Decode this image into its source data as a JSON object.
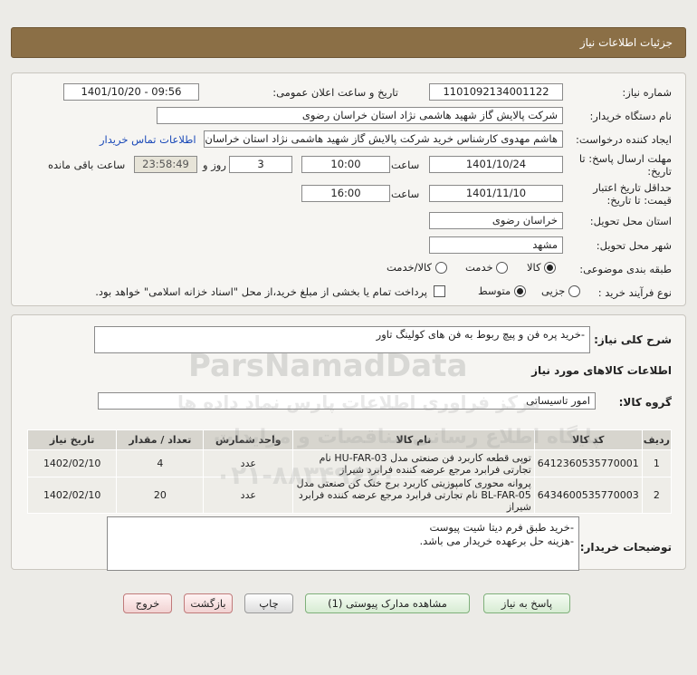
{
  "header": {
    "title": "جزئیات اطلاعات نیاز"
  },
  "info": {
    "need_number_label": "شماره نیاز:",
    "need_number": "1101092134001122",
    "announce_label": "تاریخ و ساعت اعلان عمومی:",
    "announce_value": "1401/10/20 - 09:56",
    "buyer_org_label": "نام دستگاه خریدار:",
    "buyer_org": "شرکت پالایش گاز شهید هاشمی نژاد   استان خراسان رضوی",
    "creator_label": "ایجاد کننده درخواست:",
    "creator": "هاشم مهدوی کارشناس خرید شرکت پالایش گاز شهید هاشمی نژاد   استان خراسان رضوی",
    "contact_link": "اطلاعات تماس خریدار",
    "deadline_label_1": "مهلت ارسال پاسخ: تا",
    "deadline_label_2": "تاریخ:",
    "deadline_date": "1401/10/24",
    "time_label": "ساعت",
    "deadline_time": "10:00",
    "days_value": "3",
    "days_label": "روز و",
    "remaining_time": "23:58:49",
    "remaining_label": "ساعت باقی مانده",
    "validity_label_1": "حداقل تاریخ اعتبار",
    "validity_label_2": "قیمت: تا تاریخ:",
    "validity_date": "1401/11/10",
    "validity_time": "16:00",
    "province_label": "استان محل تحویل:",
    "province": "خراسان رضوی",
    "city_label": "شهر محل تحویل:",
    "city": "مشهد",
    "category_label": "طبقه بندی موضوعی:",
    "category_options": [
      "کالا",
      "خدمت",
      "کالا/خدمت"
    ],
    "process_label": "نوع فرآیند خرید :",
    "process_options": [
      "جزیی",
      "متوسط"
    ],
    "payment_note": "پرداخت تمام یا بخشی از مبلغ خرید،از محل \"اسناد خزانه اسلامی\" خواهد بود."
  },
  "description": {
    "label": "شرح کلی نیاز:",
    "value": "-خرید پره فن و پیچ ربوط به فن های کولینگ تاور"
  },
  "goods": {
    "section_title": "اطلاعات کالاهای مورد نیاز",
    "group_label": "گروه کالا:",
    "group_value": "امور تاسیساتی",
    "columns": [
      "ردیف",
      "کد کالا",
      "نام کالا",
      "واحد شمارش",
      "تعداد / مقدار",
      "تاریخ نیاز"
    ],
    "rows": [
      {
        "row": "1",
        "code": "6412360535770001",
        "name": "توپی قطعه کاربرد فن صنعتی مدل HU-FAR-03 نام تجارتی فرابرد مرجع عرضه کننده فرابرد شیراز",
        "unit": "عدد",
        "qty": "4",
        "date": "1402/02/10"
      },
      {
        "row": "2",
        "code": "6434600535770003",
        "name": "پروانه محوری کامپوزیتی کاربرد برج خنک کن صنعتی مدل BL-FAR-05 نام تجارتی فرابرد مرجع عرضه کننده فرابرد شیراز",
        "unit": "عدد",
        "qty": "20",
        "date": "1402/02/10"
      }
    ]
  },
  "buyer_notes": {
    "label": "توضیحات خریدار:",
    "line1": "-خرید طبق فرم دیتا شیت پیوست",
    "line2": "-هزینه حل برعهده خریدار می باشد."
  },
  "buttons": {
    "reply": "پاسخ به نیاز",
    "view_docs": "مشاهده مدارک پیوستی (1)",
    "print": "چاپ",
    "back": "بازگشت",
    "exit": "خروج"
  },
  "watermark": {
    "brand": "ParsNamadData",
    "line_fa_1": "مرکز فراوری اطلاعات پارس نماد داده ها",
    "line_fa_2": "پایگاه اطلاع رسانی مناقصات و مزایدات",
    "phone": "۰۲۱-۸۸۳۴۹۶۷۰"
  }
}
